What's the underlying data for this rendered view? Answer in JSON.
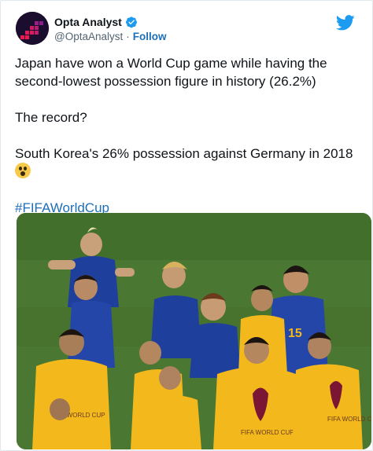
{
  "tweet": {
    "display_name": "Opta Analyst",
    "handle": "@OptaAnalyst",
    "separator": "·",
    "follow_label": "Follow",
    "verified_icon": "verified-badge-icon",
    "brand_icon": "twitter-bird-icon",
    "paragraphs": [
      "Japan have won a World Cup game while having the second-lowest possession figure in history (26.2%)",
      "The record?",
      "South Korea's 26% possession against Germany in 2018"
    ],
    "emoji_icon": "astonished-face-emoji",
    "hashtag": "#FIFAWorldCup",
    "photo_icon": "japan-team-celebration-photo"
  },
  "colors": {
    "link": "#1d6fb8",
    "twitter_blue": "#1d9bf0",
    "text": "#0f1419",
    "muted": "#536471",
    "japan_blue": "#1f3f9c",
    "bib_yellow": "#f2b81c",
    "pitch_green": "#4b7a33"
  }
}
